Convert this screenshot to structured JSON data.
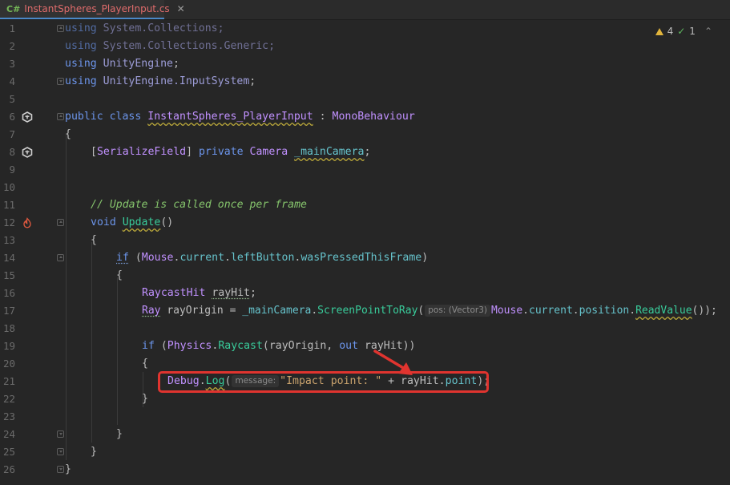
{
  "tab": {
    "lang": "C#",
    "filename": "InstantSpheres_PlayerInput.cs",
    "close": "✕"
  },
  "inspections": {
    "warnings": "4",
    "passed": "1",
    "chevron": "⌃"
  },
  "lines": [
    "1",
    "2",
    "3",
    "4",
    "5",
    "6",
    "7",
    "8",
    "9",
    "10",
    "11",
    "12",
    "13",
    "14",
    "15",
    "16",
    "17",
    "18",
    "19",
    "20",
    "21",
    "22",
    "23",
    "24",
    "25",
    "26"
  ],
  "code": {
    "l1_kw": "using",
    "l1_ns": "System.Collections;",
    "l2_kw": "using",
    "l2_ns": "System.Collections.Generic;",
    "l3_kw": "using",
    "l3_ns": "UnityEngine",
    "l3_end": ";",
    "l4_kw": "using",
    "l4_ns": "UnityEngine.InputSystem",
    "l4_end": ";",
    "l6_kw1": "public",
    "l6_kw2": "class",
    "l6_cls": "InstantSpheres_PlayerInput",
    "l6_colon": ":",
    "l6_base": "MonoBehaviour",
    "l7": "{",
    "l8_open": "[",
    "l8_attr": "SerializeField",
    "l8_close": "]",
    "l8_kw": "private",
    "l8_type": "Camera",
    "l8_field": "_mainCamera",
    "l8_end": ";",
    "l11": "// Update is called once per frame",
    "l12_kw": "void",
    "l12_m": "Update",
    "l12_p": "()",
    "l13": "{",
    "l14_kw": "if",
    "l14_p1": "(",
    "l14_t": "Mouse",
    "l14_d1": ".",
    "l14_f1": "current",
    "l14_d2": ".",
    "l14_f2": "leftButton",
    "l14_d3": ".",
    "l14_f3": "wasPressedThisFrame",
    "l14_p2": ")",
    "l15": "{",
    "l16_t": "RaycastHit",
    "l16_v": "rayHit",
    "l16_e": ";",
    "l17_t": "Ray",
    "l17_v": "rayOrigin",
    "l17_eq": "=",
    "l17_f": "_mainCamera",
    "l17_d": ".",
    "l17_m": "ScreenPointToRay",
    "l17_p": "(",
    "l17_hint_name": "pos:",
    "l17_hint_type": "(Vector3)",
    "l17_t2": "Mouse",
    "l17_d2": ".",
    "l17_f2": "current",
    "l17_d3": ".",
    "l17_f3": "position",
    "l17_d4": ".",
    "l17_m2": "ReadValue",
    "l17_end": "());",
    "l19_kw": "if",
    "l19_p": "(",
    "l19_t": "Physics",
    "l19_d": ".",
    "l19_m": "Raycast",
    "l19_a": "(rayOrigin, ",
    "l19_kw2": "out",
    "l19_b": " rayHit))",
    "l20": "{",
    "l21_t": "Debug",
    "l21_d": ".",
    "l21_m": "Log",
    "l21_p": "(",
    "l21_hint": "message:",
    "l21_s": "\"Impact point: \"",
    "l21_plus": " + rayHit.",
    "l21_f": "point",
    "l21_end": ");",
    "l22": "}",
    "l24": "}",
    "l25": "}",
    "l26": "}"
  },
  "colors": {
    "highlight": "#e0342f",
    "arrow": "#e0342f"
  }
}
